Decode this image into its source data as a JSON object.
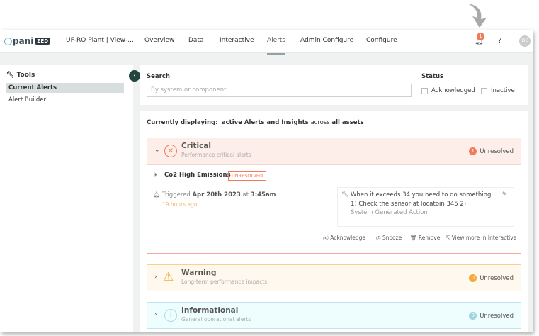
{
  "header": {
    "brand": "pani",
    "brand_suffix": "ZED",
    "project": "UF-RO Plant | View-...",
    "nav": [
      "Overview",
      "Data",
      "Interactive",
      "Alerts",
      "Admin Configure",
      "Configure"
    ],
    "active_nav": "Alerts",
    "notification_count": "1",
    "help": "?",
    "avatar": "DC"
  },
  "sidebar": {
    "title": "Tools",
    "items": [
      "Current Alerts",
      "Alert Builder"
    ],
    "selected": "Current Alerts"
  },
  "search": {
    "label": "Search",
    "placeholder": "By system or component",
    "status_label": "Status",
    "status_options": [
      "Acknowledged",
      "Inactive"
    ]
  },
  "display": {
    "prefix": "Currently displaying:",
    "bold1": "active Alerts and Insights",
    "mid": "across",
    "bold2": "all assets"
  },
  "groups": [
    {
      "name": "Critical",
      "subtitle": "Performance critical alerts",
      "count": "1",
      "count_label": "Unresolved",
      "color": "#f07a5a"
    },
    {
      "name": "Warning",
      "subtitle": "Long-term performance impacts",
      "count": "0",
      "count_label": "Unresolved",
      "color": "#f5a93b"
    },
    {
      "name": "Informational",
      "subtitle": "General operational alerts",
      "count": "0",
      "count_label": "Unresolved",
      "color": "#8fd0e0"
    }
  ],
  "alert": {
    "title": "Co2 High Emissions",
    "status": "UNRESOLVED",
    "triggered_prefix": "Triggered",
    "triggered_date": "Apr 20th 2023",
    "triggered_at": "at",
    "triggered_time": "3:45am",
    "ago": "19 hours ago",
    "action_text": "When it exceeds 34 you need to do something. 1) Check the sensor at locatoin 345 2)",
    "action_source": "System Generated Action",
    "actions": [
      "Acknowledge",
      "Snooze",
      "Remove",
      "View more in Interactive"
    ]
  }
}
